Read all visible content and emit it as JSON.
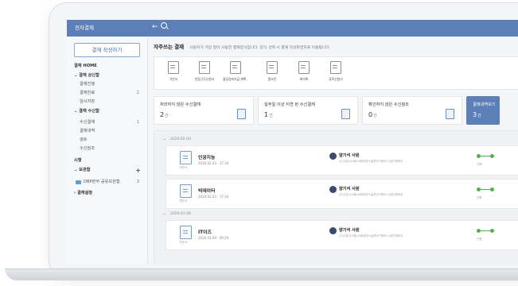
{
  "app": {
    "title": "전자결재"
  },
  "sidebar": {
    "write_button": "결재 작성하기",
    "home": "결재 HOME",
    "sent_section": "결재 상신함",
    "sent_items": [
      {
        "label": "결재진행",
        "count": ""
      },
      {
        "label": "결재완료",
        "count": "2"
      },
      {
        "label": "임시저장",
        "count": ""
      }
    ],
    "recv_section": "결재 수신함",
    "recv_items": [
      {
        "label": "수신결재",
        "count": "1"
      },
      {
        "label": "결재내역",
        "count": ""
      },
      {
        "label": "검토",
        "count": ""
      },
      {
        "label": "수신참조",
        "count": ""
      }
    ],
    "sihaeng": "시행",
    "archive_section": "보관함",
    "folder_label": "DBP본부 공유보관함",
    "folder_count": "3",
    "settings": "결재설정"
  },
  "main": {
    "title": "자주쓰는 결재",
    "description": "사용자가 가장 많이 사용한 결재양식입니다. 양식 선택 시 결재 작성화면으로 이동됩니다.",
    "forms": [
      {
        "label": "기안서"
      },
      {
        "label": "연장근무신청서"
      },
      {
        "label": "출장경비지급 계획 -"
      },
      {
        "label": "협조전"
      },
      {
        "label": "회의록"
      },
      {
        "label": "휴직신청서"
      }
    ],
    "stats": [
      {
        "label": "처리하지 않은 수신결재",
        "value": "2",
        "unit": "건"
      },
      {
        "label": "일주일 이상 지연 된 수신결재",
        "value": "1",
        "unit": "건"
      },
      {
        "label": "확인하지 않은 수신참조",
        "value": "0",
        "unit": "건"
      },
      {
        "label": "결재내역보기",
        "value": "3",
        "unit": "건"
      }
    ],
    "groups": [
      {
        "date": "2020.02.03",
        "docs": [
          {
            "title": "인공지능",
            "date": "2020.02.03 · 17:34",
            "type": "기안서",
            "user": "양기석 사원",
            "dept": "(주)다온시스템>DBP본부>솔루션기획부>사업기획파트",
            "status": "진행"
          },
          {
            "title": "빅데이터",
            "date": "2020.02.03 · 17:34",
            "type": "기안서",
            "user": "양기석 사원",
            "dept": "(주)다온시스템>DBP본부>솔루션기획부>사업기획파트",
            "status": "진행"
          }
        ]
      },
      {
        "date": "2020.01.09",
        "docs": [
          {
            "title": "IT이즈",
            "date": "2020.01.09 · 09:29",
            "type": "기안서",
            "user": "양기석 사원",
            "dept": "(주)다온시스템>DBP본부>솔루션기획부>사업기획파트",
            "status": "진행"
          }
        ]
      }
    ]
  },
  "colors": {
    "brand": "#5b7fb6",
    "progress": "#52b14a"
  }
}
